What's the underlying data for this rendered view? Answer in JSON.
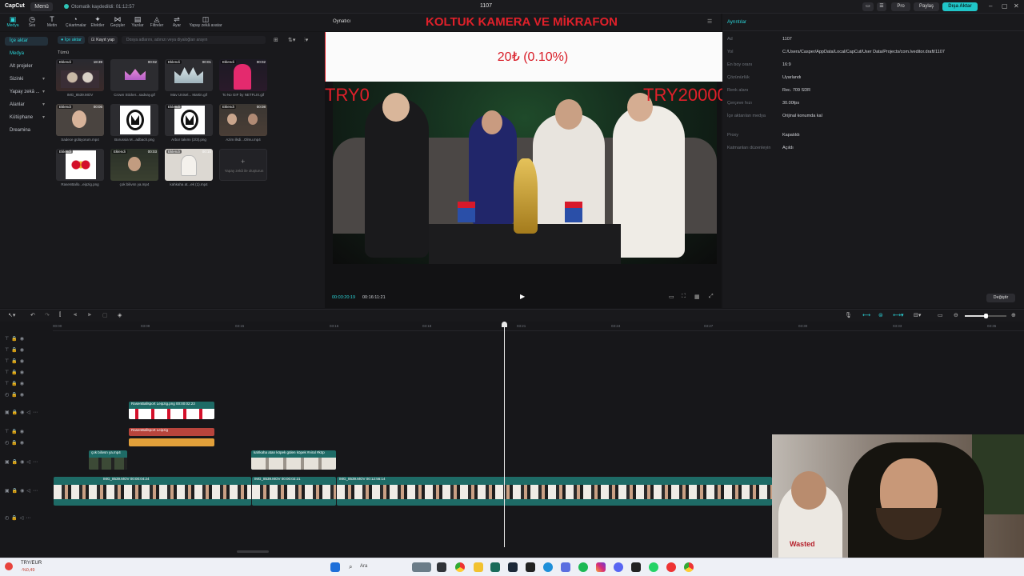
{
  "titlebar": {
    "logo": "CapCut",
    "menu_label": "Menü",
    "autosave": "Otomatik kaydedildi: 01:12:57",
    "project_title": "1107",
    "pro_label": "Pro",
    "share_label": "Paylaş",
    "export_label": "Dışa Aktar"
  },
  "toolbar": {
    "items": [
      "Medya",
      "Ses",
      "Metin",
      "Çıkartmalar",
      "Efektler",
      "Geçişler",
      "Yazılar",
      "Filtreler",
      "Ayar",
      "Yapay zekâ avatar"
    ]
  },
  "left_nav": {
    "items": [
      "İçe aktar",
      "Medya",
      "Alt projeler",
      "Sizinki",
      "Yapay zekâ ...",
      "Alanlar",
      "Kütüphane",
      "Dreamina"
    ]
  },
  "media_panel": {
    "import_label": "İçe aktar",
    "record_label": "Kayıt yap",
    "search_placeholder": "Dosya adlarını, adınızı veya diyaloğları arayın",
    "section_label": "Tümü",
    "added_tag": "Eklendi",
    "ai_placeholder": "Yapay zekâ ile oluşturun",
    "items": [
      {
        "label": "IMG_8539.MOV",
        "duration": "18:39"
      },
      {
        "label": "Crown Sticker...sadvay.gif",
        "duration": "00:02"
      },
      {
        "label": "Mav Unisel... Martin.gif",
        "duration": "00:01"
      },
      {
        "label": "To No GIF by NETFLIX.gif",
        "duration": "00:02"
      },
      {
        "label": "Sadece gülüyorum.mp4",
        "duration": "00:06"
      },
      {
        "label": "Borussia M...adbach.png",
        "duration": ""
      },
      {
        "label": "Arbor takımı (2/3).png",
        "duration": ""
      },
      {
        "label": "Azim ilkdi...Olmu.mp4",
        "duration": "00:08"
      },
      {
        "label": "RasenBallo...eipzig.png",
        "duration": ""
      },
      {
        "label": "çok bilivsn ya.mp4",
        "duration": "00:03"
      },
      {
        "label": "kahkaha at...ek (1).mp4",
        "duration": "00:10"
      }
    ]
  },
  "player": {
    "header": "Oynatıcı",
    "overlay_title": "KOLTUK KAMERA VE MİKRAFON",
    "progress_text": "20₺ (0.10%)",
    "progress_fraction": 0.001,
    "left_amount": "TRY0",
    "right_amount": "TRY20000",
    "current_time": "00:03:20:19",
    "total_time": "00:16:11:21"
  },
  "details": {
    "header": "Ayrıntılar",
    "rows": [
      {
        "key": "Ad",
        "value": "1107"
      },
      {
        "key": "Yol",
        "value": "C:/Users/Casper/AppData/Local/CapCut/User Data/Projects/com.lveditor.draft/1107"
      },
      {
        "key": "En boy oranı",
        "value": "16:9"
      },
      {
        "key": "Çözünürlük",
        "value": "Uyarlandı"
      },
      {
        "key": "Renk alanı",
        "value": "Rec. 709 SDR"
      },
      {
        "key": "Çerçeve hızı",
        "value": "30.00fps"
      },
      {
        "key": "İçe aktarılan medya",
        "value": "Orijinal konumda kal"
      },
      {
        "key": "Proxy",
        "value": "Kapatıldı"
      },
      {
        "key": "Katmanları düzenleyin",
        "value": "Açıldı"
      }
    ],
    "modify_label": "Değiştir"
  },
  "timeline": {
    "ticks": [
      "00:00",
      "03:09",
      "03:15",
      "03:16",
      "03:18",
      "03:21",
      "03:24",
      "03:27",
      "03:30",
      "03:33",
      "03:36"
    ],
    "clips": {
      "rb_image": "RasenBallsport Leipzig.png  00:00:02:23",
      "rb_text": "RasenBallsport Leipzig",
      "cok_bilivsn": "çok bilivsn ya.mp4",
      "kahkaha": "kahkaha atan köpek gülen köpek #viral #köp",
      "main1": "IMG_8539.MOV  00:00:04:24",
      "main2": "IMG_8539.MOV  00:00:02:21",
      "main3": "IMG_8539.MOV  00:12:56:14"
    }
  },
  "taskbar": {
    "weather_pair": "TRY/EUR",
    "weather_change": "-%0,49",
    "search_label": "Ara"
  },
  "colors": {
    "accent": "#2ad4d8",
    "overlay_red": "#e0202a",
    "clip_teal": "#1e6b66",
    "clip_red": "#c0392b",
    "clip_orange": "#e2a03a"
  }
}
